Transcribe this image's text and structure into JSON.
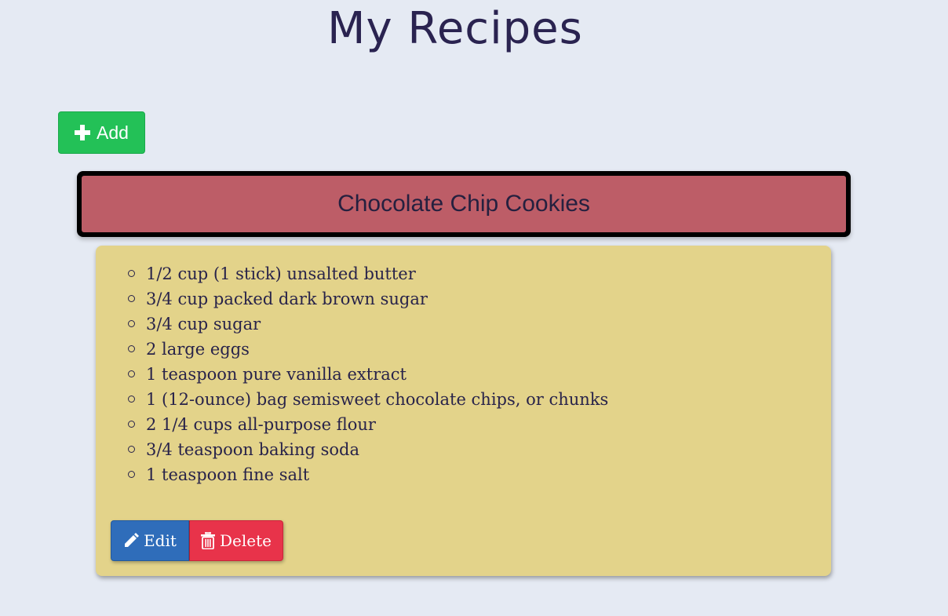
{
  "header": {
    "title": "My Recipes"
  },
  "toolbar": {
    "add_label": "Add",
    "add_icon": "plus-icon",
    "add_color": "#23c157"
  },
  "recipe": {
    "title": "Chocolate Chip Cookies",
    "header_color": "#bd5d67",
    "body_color": "#e3d38a",
    "ingredients": [
      "1/2 cup (1 stick) unsalted butter",
      "3/4 cup packed dark brown sugar",
      "3/4 cup sugar",
      "2 large eggs",
      "1 teaspoon pure vanilla extract",
      "1 (12-ounce) bag semisweet chocolate chips, or chunks",
      "2 1/4 cups all-purpose flour",
      "3/4 teaspoon baking soda",
      "1 teaspoon fine salt"
    ],
    "actions": {
      "edit_label": "Edit",
      "edit_icon": "pencil-icon",
      "edit_color": "#2f6dba",
      "delete_label": "Delete",
      "delete_icon": "trash-icon",
      "delete_color": "#e8334a"
    }
  }
}
